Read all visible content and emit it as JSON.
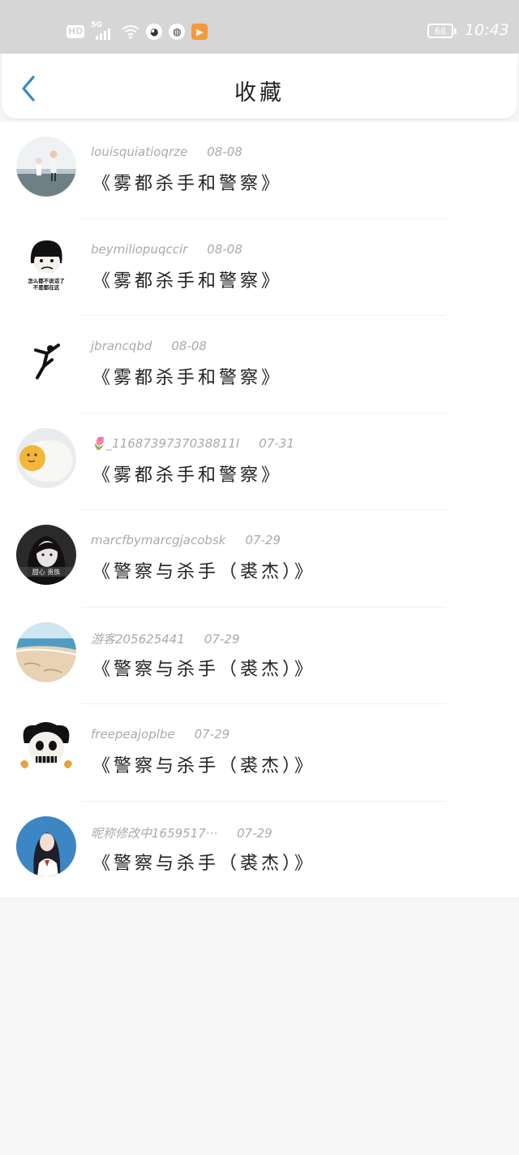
{
  "status_bar": {
    "hd": "HD",
    "network": "5G",
    "battery": "68",
    "time": "10:43"
  },
  "header": {
    "title": "收藏"
  },
  "items": [
    {
      "user": "louisquiatioqrze",
      "date": "08-08",
      "title": "《雾都杀手和警察》"
    },
    {
      "user": "beymiliopuqccir",
      "date": "08-08",
      "title": "《雾都杀手和警察》",
      "avatar_text": "怎么都不说话了\n不是都在这"
    },
    {
      "user": "jbrancqbd",
      "date": "08-08",
      "title": "《雾都杀手和警察》"
    },
    {
      "user": "🌷_1168739737038811I",
      "date": "07-31",
      "title": "《雾都杀手和警察》"
    },
    {
      "user": "marcfbymarcgjacobsk",
      "date": "07-29",
      "title": "《警察与杀手（裘杰）》",
      "avatar_text": "甜心 贵族"
    },
    {
      "user": "游客205625441",
      "date": "07-29",
      "title": "《警察与杀手（裘杰）》"
    },
    {
      "user": "freepeajoplbe",
      "date": "07-29",
      "title": "《警察与杀手（裘杰）》"
    },
    {
      "user": "昵称修改中1659517···",
      "date": "07-29",
      "title": "《警察与杀手（裘杰）》"
    }
  ]
}
